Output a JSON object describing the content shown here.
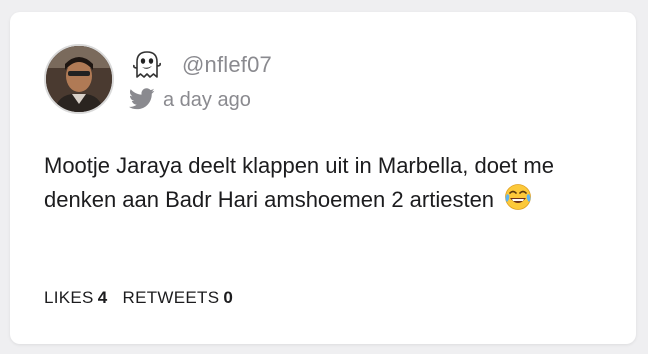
{
  "tweet": {
    "handle": "@nflef07",
    "timestamp": "a day ago",
    "text": "Mootje Jaraya deelt klappen uit in Marbella, doet me denken aan Badr Hari amshoemen 2 artiesten",
    "emoji": "face-with-tears-of-joy-icon",
    "likes_label": "LIKES",
    "likes_count": "4",
    "retweets_label": "RETWEETS",
    "retweets_count": "0"
  },
  "icons": {
    "ghost": "ghost-icon",
    "bird": "twitter-bird-icon"
  },
  "colors": {
    "background": "#efeff1",
    "card": "#ffffff",
    "muted_text": "#8a8a8f",
    "body_text": "#1c1c1e"
  }
}
